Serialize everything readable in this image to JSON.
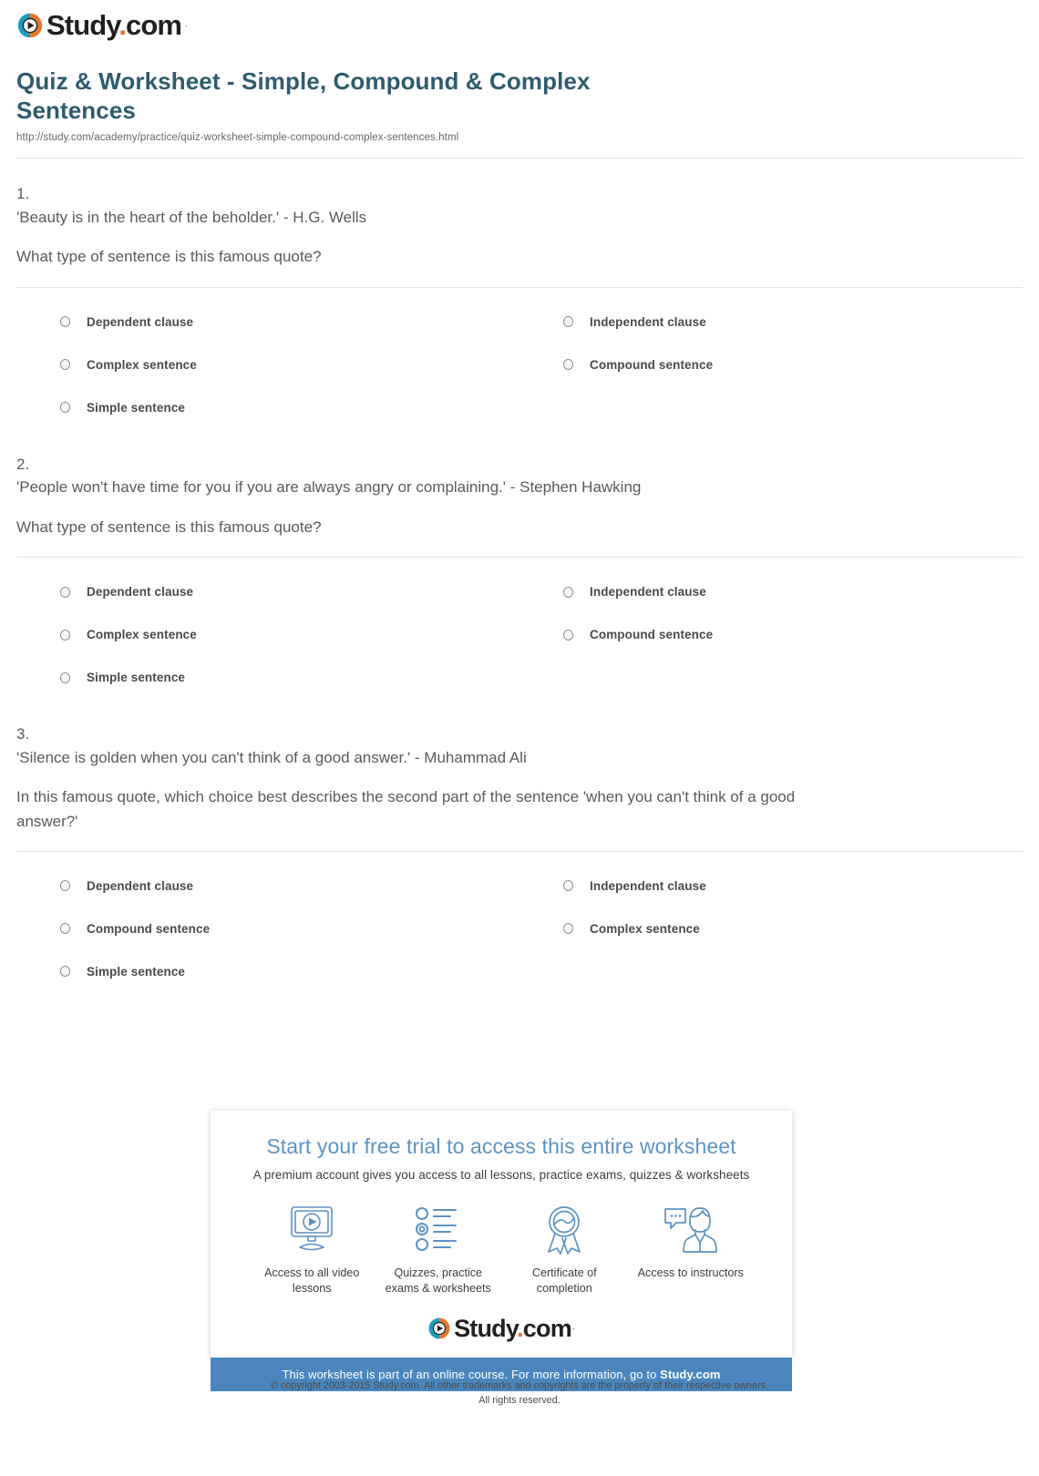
{
  "brand": {
    "name_main": "Study",
    "name_dot": ".",
    "name_tld": "com",
    "trademark": "·",
    "colors": {
      "teal": "#1b9dc1",
      "orange": "#e8762d",
      "title": "#2d5c6e",
      "banner": "#4a86bd"
    }
  },
  "header": {
    "title": "Quiz & Worksheet - Simple, Compound & Complex Sentences",
    "url": "http://study.com/academy/practice/quiz-worksheet-simple-compound-complex-sentences.html"
  },
  "questions": [
    {
      "number": "1.",
      "quote": "'Beauty is in the heart of the beholder.' - H.G. Wells",
      "prompt": "What type of sentence is this famous quote?",
      "answers": [
        "Dependent clause",
        "Independent clause",
        "Complex sentence",
        "Compound sentence",
        "Simple sentence"
      ]
    },
    {
      "number": "2.",
      "quote": "'People won't have time for you if you are always angry or complaining.' - Stephen Hawking",
      "prompt": "What type of sentence is this famous quote?",
      "answers": [
        "Dependent clause",
        "Independent clause",
        "Complex sentence",
        "Compound sentence",
        "Simple sentence"
      ]
    },
    {
      "number": "3.",
      "quote": "'Silence is golden when you can't think of a good answer.' - Muhammad Ali",
      "prompt": "In this famous quote, which choice best describes the second part of the sentence 'when you can't think of a good answer?'",
      "answers": [
        "Dependent clause",
        "Independent clause",
        "Compound sentence",
        "Complex sentence",
        "Simple sentence"
      ]
    }
  ],
  "promo": {
    "headline": "Start your free trial to access this entire worksheet",
    "subtitle": "A premium account gives you access to all lessons, practice exams, quizzes & worksheets",
    "features": [
      {
        "icon": "monitor-play-icon",
        "label": "Access to all video lessons"
      },
      {
        "icon": "checklist-icon",
        "label": "Quizzes, practice exams & worksheets"
      },
      {
        "icon": "award-ribbon-icon",
        "label": "Certificate of completion"
      },
      {
        "icon": "instructor-chat-icon",
        "label": "Access to instructors"
      }
    ],
    "banner_text": "This worksheet is part of an online course. For more information, go to ",
    "banner_link": "Study.com"
  },
  "footer": {
    "line1": "© copyright 2003-2015 Study.com. All other trademarks and copyrights are the property of their respective owners.",
    "line2": "All rights reserved."
  }
}
